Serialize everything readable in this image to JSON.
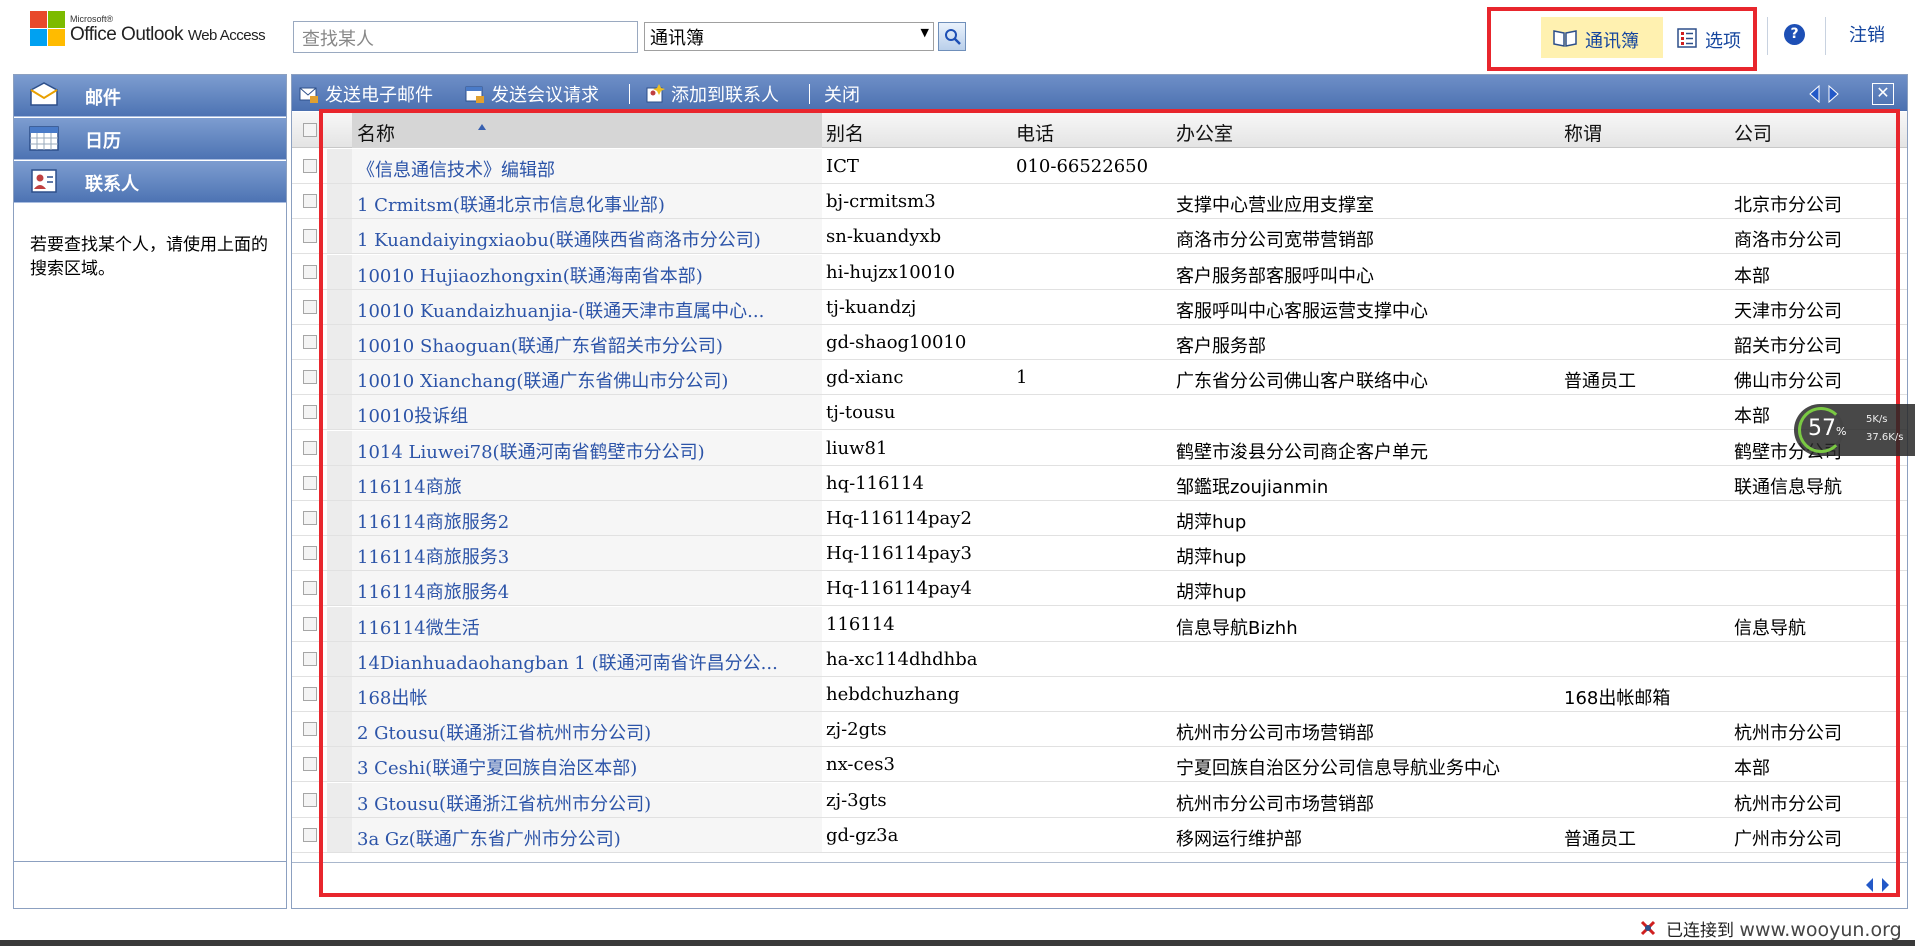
{
  "app": {
    "brand_small": "Microsoft®",
    "brand_name": "Office Outlook",
    "brand_suffix": "Web Access"
  },
  "search": {
    "placeholder": "查找某人",
    "scope": "通讯簿"
  },
  "top_actions": {
    "address_book": "通讯簿",
    "options": "选项",
    "help": "?",
    "logout": "注销"
  },
  "nav": {
    "items": [
      {
        "label": "邮件",
        "icon": "mail-icon"
      },
      {
        "label": "日历",
        "icon": "calendar-icon"
      },
      {
        "label": "联系人",
        "icon": "contacts-icon"
      }
    ],
    "help_text": "若要查找某个人，请使用上面的搜索区域。"
  },
  "toolbar": {
    "send_email": "发送电子邮件",
    "send_meeting": "发送会议请求",
    "add_contact": "添加到联系人",
    "close": "关闭"
  },
  "columns": {
    "name": "名称",
    "alias": "别名",
    "phone": "电话",
    "office": "办公室",
    "title": "称谓",
    "company": "公司"
  },
  "rows": [
    {
      "name": "《信息通信技术》编辑部",
      "alias": "ICT",
      "phone": "010-66522650",
      "office": "",
      "title": "",
      "company": ""
    },
    {
      "name": "1 Crmitsm(联通北京市信息化事业部)",
      "alias": "bj-crmitsm3",
      "phone": "",
      "office": "支撑中心营业应用支撑室",
      "title": "",
      "company": "北京市分公司"
    },
    {
      "name": "1 Kuandaiyingxiaobu(联通陕西省商洛市分公司)",
      "alias": "sn-kuandyxb",
      "phone": "",
      "office": "商洛市分公司宽带营销部",
      "title": "",
      "company": "商洛市分公司"
    },
    {
      "name": "10010 Hujiaozhongxin(联通海南省本部)",
      "alias": "hi-hujzx10010",
      "phone": "",
      "office": "客户服务部客服呼叫中心",
      "title": "",
      "company": "本部"
    },
    {
      "name": "10010 Kuandaizhuanjia-(联通天津市直属中心...",
      "alias": "tj-kuandzj",
      "phone": "",
      "office": "客服呼叫中心客服运营支撑中心",
      "title": "",
      "company": "天津市分公司"
    },
    {
      "name": "10010 Shaoguan(联通广东省韶关市分公司)",
      "alias": "gd-shaog10010",
      "phone": "",
      "office": "客户服务部",
      "title": "",
      "company": "韶关市分公司"
    },
    {
      "name": "10010 Xianchang(联通广东省佛山市分公司)",
      "alias": "gd-xianc",
      "phone": "1",
      "office": "广东省分公司佛山客户联络中心",
      "title": "普通员工",
      "company": "佛山市分公司"
    },
    {
      "name": "10010投诉组",
      "alias": "tj-tousu",
      "phone": "",
      "office": "",
      "title": "",
      "company": "本部"
    },
    {
      "name": "1014 Liuwei78(联通河南省鹤壁市分公司)",
      "alias": "liuw81",
      "phone": "",
      "office": "鹤壁市浚县分公司商企客户单元",
      "title": "",
      "company": "鹤壁市分公司"
    },
    {
      "name": "116114商旅",
      "alias": "hq-116114",
      "phone": "",
      "office": "邹鑑珉zoujianmin",
      "title": "",
      "company": "联通信息导航"
    },
    {
      "name": "116114商旅服务2",
      "alias": "Hq-116114pay2",
      "phone": "",
      "office": "胡萍hup",
      "title": "",
      "company": ""
    },
    {
      "name": "116114商旅服务3",
      "alias": "Hq-116114pay3",
      "phone": "",
      "office": "胡萍hup",
      "title": "",
      "company": ""
    },
    {
      "name": "116114商旅服务4",
      "alias": "Hq-116114pay4",
      "phone": "",
      "office": "胡萍hup",
      "title": "",
      "company": ""
    },
    {
      "name": "116114微生活",
      "alias": "116114",
      "phone": "",
      "office": "信息导航Bizhh",
      "title": "",
      "company": "信息导航"
    },
    {
      "name": "14Dianhuadaohangban 1 (联通河南省许昌分公...",
      "alias": "ha-xc114dhdhba",
      "phone": "",
      "office": "",
      "title": "",
      "company": ""
    },
    {
      "name": "168出帐",
      "alias": "hebdchuzhang",
      "phone": "",
      "office": "",
      "title": "168出帐邮箱",
      "company": ""
    },
    {
      "name": "2 Gtousu(联通浙江省杭州市分公司)",
      "alias": "zj-2gts",
      "phone": "",
      "office": "杭州市分公司市场营销部",
      "title": "",
      "company": "杭州市分公司"
    },
    {
      "name": "3 Ceshi(联通宁夏回族自治区本部)",
      "alias": "nx-ces3",
      "phone": "",
      "office": "宁夏回族自治区分公司信息导航业务中心",
      "title": "",
      "company": "本部"
    },
    {
      "name": "3 Gtousu(联通浙江省杭州市分公司)",
      "alias": "zj-3gts",
      "phone": "",
      "office": "杭州市分公司市场营销部",
      "title": "",
      "company": "杭州市分公司"
    },
    {
      "name": "3a Gz(联通广东省广州市分公司)",
      "alias": "gd-gz3a",
      "phone": "",
      "office": "移网运行维护部",
      "title": "普通员工",
      "company": "广州市分公司"
    }
  ],
  "status": {
    "connection": "已连接到",
    "watermark": "www.wooyun.org"
  },
  "widget": {
    "percent": "57",
    "unit": "%",
    "up": "5K/s",
    "down": "37.6K/s"
  },
  "colors": {
    "accent": "#4b70b0",
    "link": "#2c54a8",
    "highlight": "#e8262d"
  }
}
